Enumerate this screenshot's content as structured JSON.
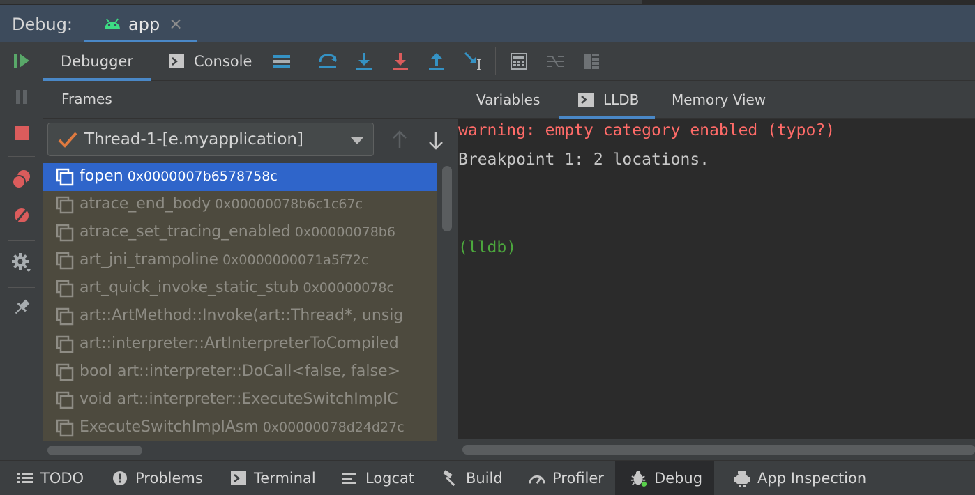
{
  "header": {
    "label": "Debug:",
    "session_tab": {
      "name": "app",
      "icon": "android-icon",
      "close": "×"
    }
  },
  "toolbar": {
    "tabs": [
      {
        "label": "Debugger",
        "active": true
      },
      {
        "label": "Console",
        "icon": "console-icon",
        "active": false
      }
    ],
    "icons": [
      "threads-dump-icon",
      "show-execution-point-icon",
      "step-over-icon",
      "step-into-icon",
      "force-step-into-icon",
      "step-out-icon",
      "run-to-cursor-icon",
      "evaluate-expression-icon",
      "trace-current-stream-icon",
      "layout-icon"
    ]
  },
  "sidebar": {
    "icons": [
      "resume-icon",
      "pause-icon",
      "stop-icon",
      "view-breakpoints-icon",
      "mute-breakpoints-icon",
      "settings-icon",
      "pin-icon"
    ]
  },
  "frames": {
    "title": "Frames",
    "thread": "Thread-1-[e.myapplication]",
    "rows": [
      {
        "name": "fopen",
        "addr": " 0x0000007b6578758c",
        "selected": true
      },
      {
        "name": "atrace_end_body",
        "addr": " 0x00000078b6c1c67c",
        "selected": false
      },
      {
        "name": "atrace_set_tracing_enabled",
        "addr": " 0x00000078b6",
        "selected": false
      },
      {
        "name": "art_jni_trampoline",
        "addr": " 0x0000000071a5f72c",
        "selected": false
      },
      {
        "name": "art_quick_invoke_static_stub",
        "addr": " 0x00000078c",
        "selected": false
      },
      {
        "name": "art::ArtMethod::Invoke(art::Thread*, unsig",
        "addr": "",
        "selected": false
      },
      {
        "name": "art::interpreter::ArtInterpreterToCompiled",
        "addr": "",
        "selected": false
      },
      {
        "name": "bool art::interpreter::DoCall<false, false>",
        "addr": "",
        "selected": false
      },
      {
        "name": "void art::interpreter::ExecuteSwitchImplC",
        "addr": "",
        "selected": false
      },
      {
        "name": "ExecuteSwitchImplAsm",
        "addr": " 0x00000078d24d27c",
        "selected": false
      }
    ]
  },
  "right": {
    "tabs": [
      {
        "label": "Variables",
        "active": false
      },
      {
        "label": "LLDB",
        "icon": "console-icon",
        "active": true
      },
      {
        "label": "Memory View",
        "active": false
      }
    ],
    "console": {
      "warning": "warning: empty category enabled (typo?)",
      "breakpoint": "Breakpoint 1: 2 locations.",
      "prompt": "(lldb)"
    }
  },
  "bottombar": {
    "items": [
      {
        "label": "TODO",
        "icon": "list-icon",
        "active": false
      },
      {
        "label": "Problems",
        "icon": "problems-icon",
        "active": false
      },
      {
        "label": "Terminal",
        "icon": "terminal-icon",
        "active": false
      },
      {
        "label": "Logcat",
        "icon": "logcat-icon",
        "active": false
      },
      {
        "label": "Build",
        "icon": "hammer-icon",
        "active": false
      },
      {
        "label": "Profiler",
        "icon": "gauge-icon",
        "active": false
      },
      {
        "label": "Debug",
        "icon": "bug-icon",
        "active": true
      },
      {
        "label": "App Inspection",
        "icon": "app-inspection-icon",
        "active": false
      }
    ]
  },
  "colors": {
    "accent": "#4a88c7",
    "selection": "#2f65ca",
    "warning": "#ff6b68",
    "prompt": "#4ca83d",
    "resume": "#59a869",
    "stop": "#db5c5c"
  }
}
